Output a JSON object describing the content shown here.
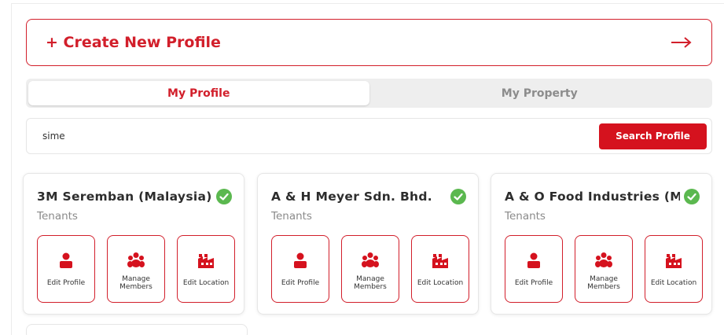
{
  "create_profile": {
    "label": "+ Create New Profile",
    "arrow_icon": "arrow-right-icon"
  },
  "tabs": [
    {
      "label": "My Profile",
      "active": true
    },
    {
      "label": "My Property",
      "active": false
    }
  ],
  "search": {
    "value": "sime",
    "button_label": "Search Profile"
  },
  "colors": {
    "accent": "#d21f2b",
    "verified": "#5bb84f"
  },
  "cards": [
    {
      "title": "3M Seremban (Malaysia) ...",
      "subtitle": "Tenants",
      "verified_icon": "check-circle-icon",
      "actions": [
        {
          "label": "Edit Profile",
          "icon": "user-icon"
        },
        {
          "label": "Manage\nMembers",
          "icon": "users-icon"
        },
        {
          "label": "Edit Location",
          "icon": "factory-icon"
        }
      ]
    },
    {
      "title": "A & H Meyer Sdn. Bhd.",
      "subtitle": "Tenants",
      "verified_icon": "check-circle-icon",
      "actions": [
        {
          "label": "Edit Profile",
          "icon": "user-icon"
        },
        {
          "label": "Manage\nMembers",
          "icon": "users-icon"
        },
        {
          "label": "Edit Location",
          "icon": "factory-icon"
        }
      ]
    },
    {
      "title": "A & O Food Industries (M)...",
      "subtitle": "Tenants",
      "verified_icon": "check-circle-icon",
      "actions": [
        {
          "label": "Edit Profile",
          "icon": "user-icon"
        },
        {
          "label": "Manage\nMembers",
          "icon": "users-icon"
        },
        {
          "label": "Edit Location",
          "icon": "factory-icon"
        }
      ]
    }
  ]
}
